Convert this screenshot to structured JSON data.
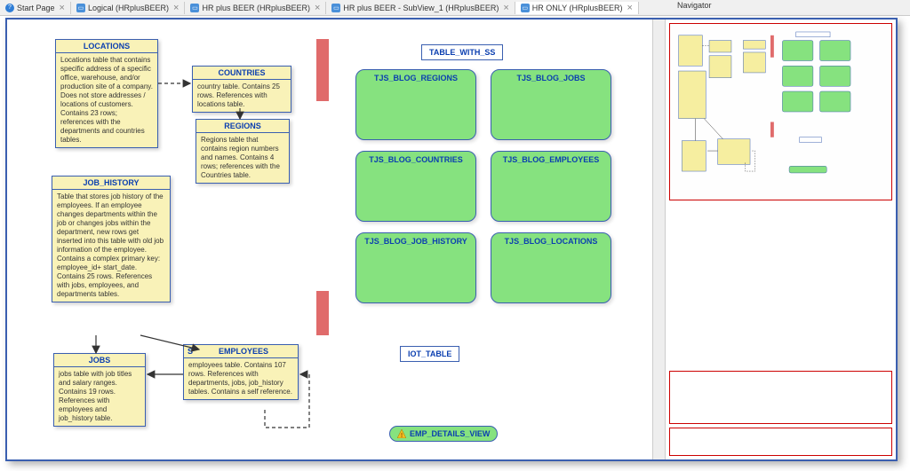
{
  "tabs": [
    {
      "label": "Start Page",
      "icon": "?"
    },
    {
      "label": "Logical (HRplusBEER)",
      "icon": "▭"
    },
    {
      "label": "HR plus BEER (HRplusBEER)",
      "icon": "▭"
    },
    {
      "label": "HR plus BEER - SubView_1 (HRplusBEER)",
      "icon": "▭"
    },
    {
      "label": "HR ONLY (HRplusBEER)",
      "icon": "▭",
      "active": true
    }
  ],
  "navigator_title": "Navigator",
  "entities": {
    "locations": {
      "title": "LOCATIONS",
      "body": "Locations table that contains specific address of a specific office, warehouse, and/or production site of a company. Does not store addresses / locations of customers. Contains 23 rows; references with the departments and countries tables."
    },
    "countries": {
      "title": "COUNTRIES",
      "body": "country table. Contains 25 rows. References with locations table."
    },
    "regions": {
      "title": "REGIONS",
      "body": "Regions table that contains region numbers and names. Contains 4 rows; references with the Countries table."
    },
    "job_history": {
      "title": "JOB_HISTORY",
      "body": "Table that stores job history of the employees. If an employee changes departments within the job or changes jobs within the department, new rows get inserted into this table with old job information of the employee. Contains a complex primary key: employee_id+ start_date. Contains 25 rows. References with jobs, employees, and departments tables."
    },
    "jobs": {
      "title": "JOBS",
      "body": "jobs table with job titles and salary ranges. Contains 19 rows. References with employees and job_history table."
    },
    "employees": {
      "title_prefix": "S",
      "title": "EMPLOYEES",
      "body": "employees table. Contains 107 rows. References with departments, jobs, job_history tables. Contains a self reference."
    }
  },
  "labels": {
    "table_with_ss": "TABLE_WITH_SS",
    "iot_table": "IOT_TABLE",
    "emp_details_view": "EMP_DETAILS_VIEW"
  },
  "green_boxes": {
    "regions": "TJS_BLOG_REGIONS",
    "jobs": "TJS_BLOG_JOBS",
    "countries": "TJS_BLOG_COUNTRIES",
    "employees": "TJS_BLOG_EMPLOYEES",
    "job_history": "TJS_BLOG_JOB_HISTORY",
    "locations": "TJS_BLOG_LOCATIONS"
  },
  "chart_data": {
    "type": "diagram",
    "nodes": [
      {
        "id": "LOCATIONS",
        "kind": "entity"
      },
      {
        "id": "COUNTRIES",
        "kind": "entity"
      },
      {
        "id": "REGIONS",
        "kind": "entity"
      },
      {
        "id": "JOB_HISTORY",
        "kind": "entity"
      },
      {
        "id": "JOBS",
        "kind": "entity"
      },
      {
        "id": "EMPLOYEES",
        "kind": "entity"
      },
      {
        "id": "TABLE_WITH_SS",
        "kind": "label"
      },
      {
        "id": "IOT_TABLE",
        "kind": "label"
      },
      {
        "id": "EMP_DETAILS_VIEW",
        "kind": "view"
      },
      {
        "id": "TJS_BLOG_REGIONS",
        "kind": "green"
      },
      {
        "id": "TJS_BLOG_JOBS",
        "kind": "green"
      },
      {
        "id": "TJS_BLOG_COUNTRIES",
        "kind": "green"
      },
      {
        "id": "TJS_BLOG_EMPLOYEES",
        "kind": "green"
      },
      {
        "id": "TJS_BLOG_JOB_HISTORY",
        "kind": "green"
      },
      {
        "id": "TJS_BLOG_LOCATIONS",
        "kind": "green"
      }
    ],
    "edges": [
      {
        "from": "LOCATIONS",
        "to": "COUNTRIES",
        "style": "dashed"
      },
      {
        "from": "COUNTRIES",
        "to": "REGIONS",
        "style": "solid"
      },
      {
        "from": "JOB_HISTORY",
        "to": "JOBS",
        "style": "solid"
      },
      {
        "from": "JOB_HISTORY",
        "to": "EMPLOYEES",
        "style": "solid"
      },
      {
        "from": "EMPLOYEES",
        "to": "JOBS",
        "style": "solid"
      },
      {
        "from": "EMPLOYEES",
        "to": "EMPLOYEES",
        "style": "dashed",
        "self": true
      }
    ]
  }
}
